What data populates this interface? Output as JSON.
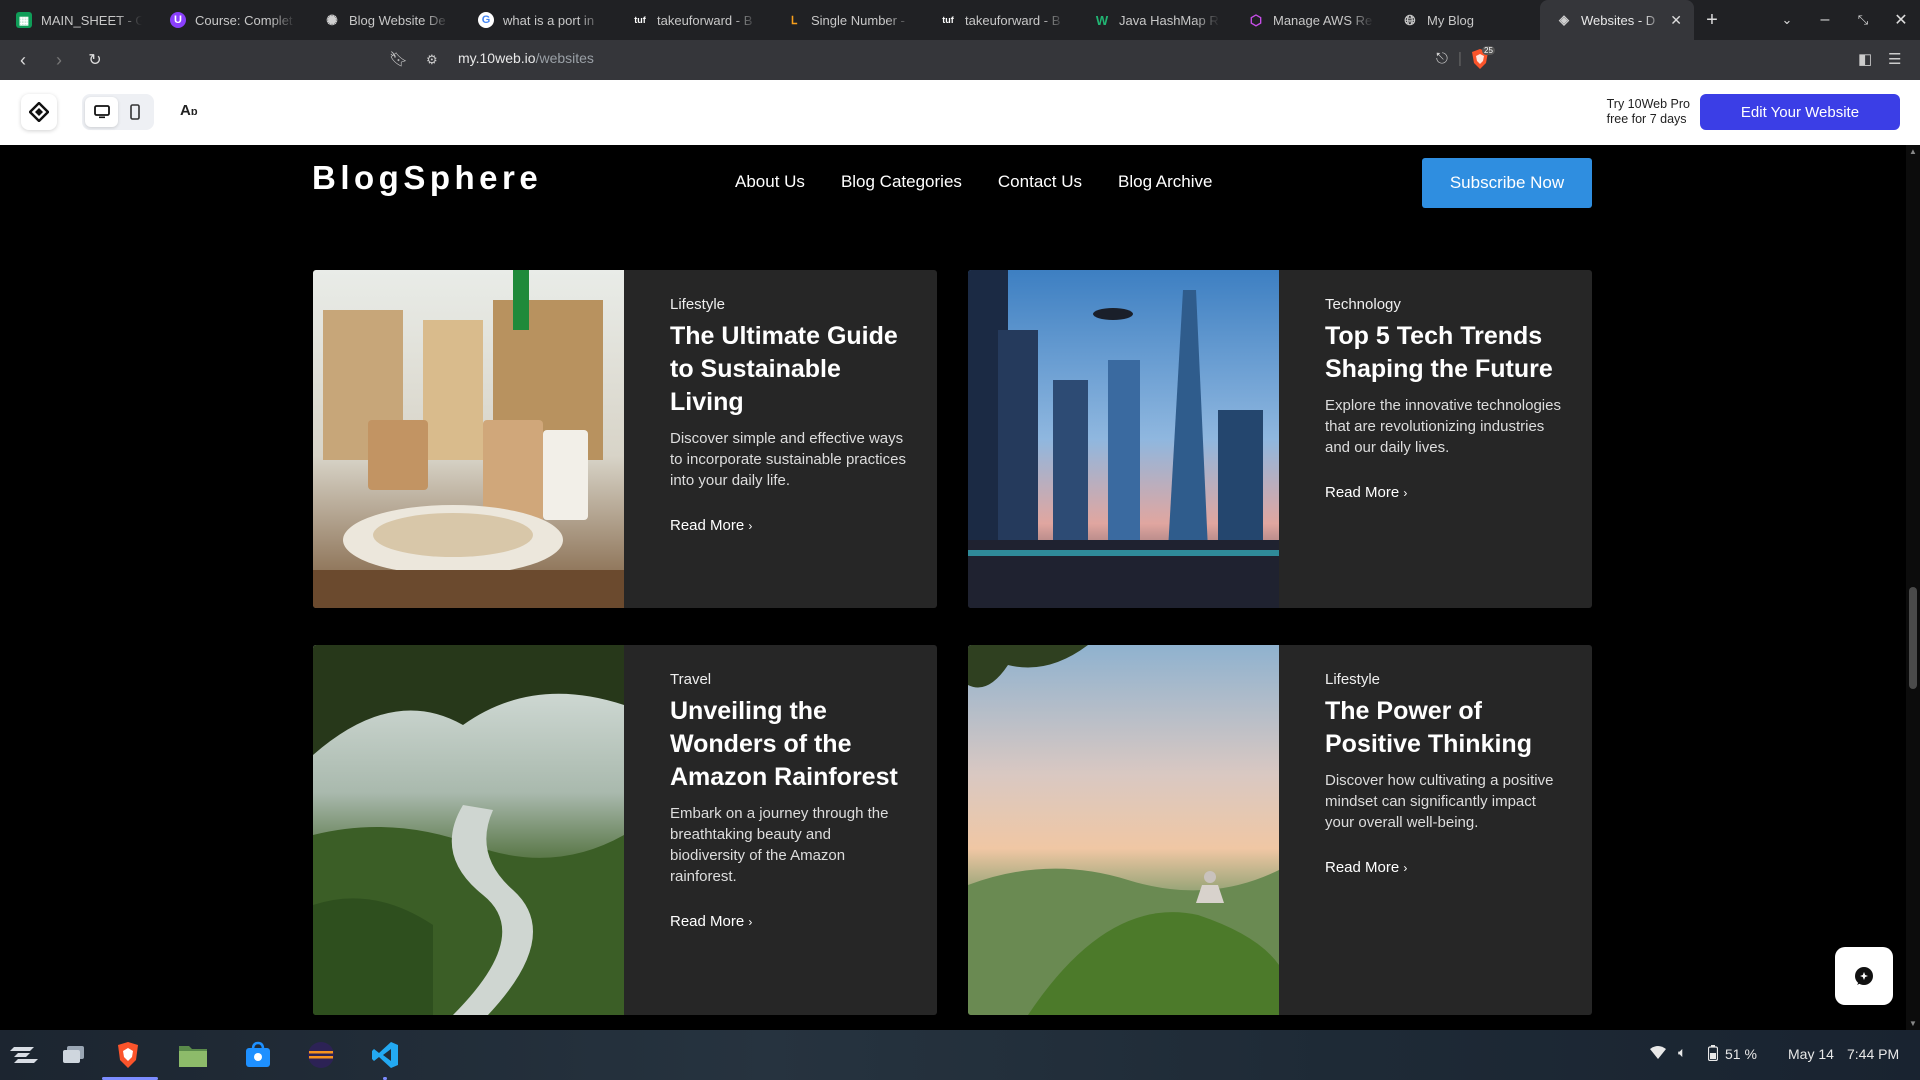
{
  "browser": {
    "tabs": [
      {
        "title": "MAIN_SHEET - G",
        "icon": "sheets-icon",
        "color": "#0f9d58"
      },
      {
        "title": "Course: Complet",
        "icon": "course-icon",
        "color": "#8a3ffc"
      },
      {
        "title": "Blog Website De",
        "icon": "chatgpt-icon",
        "color": "#d0d0d0"
      },
      {
        "title": "what is a port in",
        "icon": "google-icon",
        "color": "#4285f4"
      },
      {
        "title": "takeuforward - B",
        "icon": "tuf-icon",
        "color": "#ffffff"
      },
      {
        "title": "Single Number -",
        "icon": "leetcode-icon",
        "color": "#f89f1b"
      },
      {
        "title": "takeuforward - B",
        "icon": "tuf-icon",
        "color": "#ffffff"
      },
      {
        "title": "Java HashMap R",
        "icon": "w-icon",
        "color": "#21b573"
      },
      {
        "title": "Manage AWS Re",
        "icon": "aws-cube-icon",
        "color": "#c74ee8"
      },
      {
        "title": "My Blog",
        "icon": "globe-icon",
        "color": "#c8c8c8"
      },
      {
        "title": "Websites - D",
        "icon": "tenweb-icon",
        "color": "#d0d0d0",
        "active": true
      }
    ],
    "url_host": "my.10web.io",
    "url_path": "/websites",
    "shield_count": "25"
  },
  "tenweb": {
    "trial_line1": "Try 10Web Pro",
    "trial_line2": "free for 7 days",
    "edit_button": "Edit Your Website",
    "font_icon_label": "A"
  },
  "site": {
    "brand": "BlogSphere",
    "menu": [
      "About Us",
      "Blog Categories",
      "Contact Us",
      "Blog Archive"
    ],
    "subscribe": "Subscribe Now",
    "read_more": "Read More",
    "posts": [
      {
        "category": "Lifestyle",
        "title": "The Ultimate Guide to Sustainable Living",
        "description": "Discover simple and effective ways to incorporate sustainable practices into your daily life.",
        "image": "eco-tableware-photo"
      },
      {
        "category": "Technology",
        "title": "Top 5 Tech Trends Shaping the Future",
        "description": "Explore the innovative technologies that are revolutionizing industries and our daily lives.",
        "image": "futuristic-city-photo"
      },
      {
        "category": "Travel",
        "title": "Unveiling the Wonders of the Amazon Rainforest",
        "description": "Embark on a journey through the breathtaking beauty and biodiversity of the Amazon rainforest.",
        "image": "amazon-river-photo"
      },
      {
        "category": "Lifestyle",
        "title": "The Power of Positive Thinking",
        "description": "Discover how cultivating a positive mindset can significantly impact your overall well-being.",
        "image": "meditation-hill-photo"
      }
    ]
  },
  "taskbar": {
    "battery": "51 %",
    "date": "May 14",
    "time": "7:44 PM"
  },
  "colors": {
    "accent": "#2f8ee0",
    "edit_button": "#3b3ee6",
    "card_bg": "#262626"
  }
}
